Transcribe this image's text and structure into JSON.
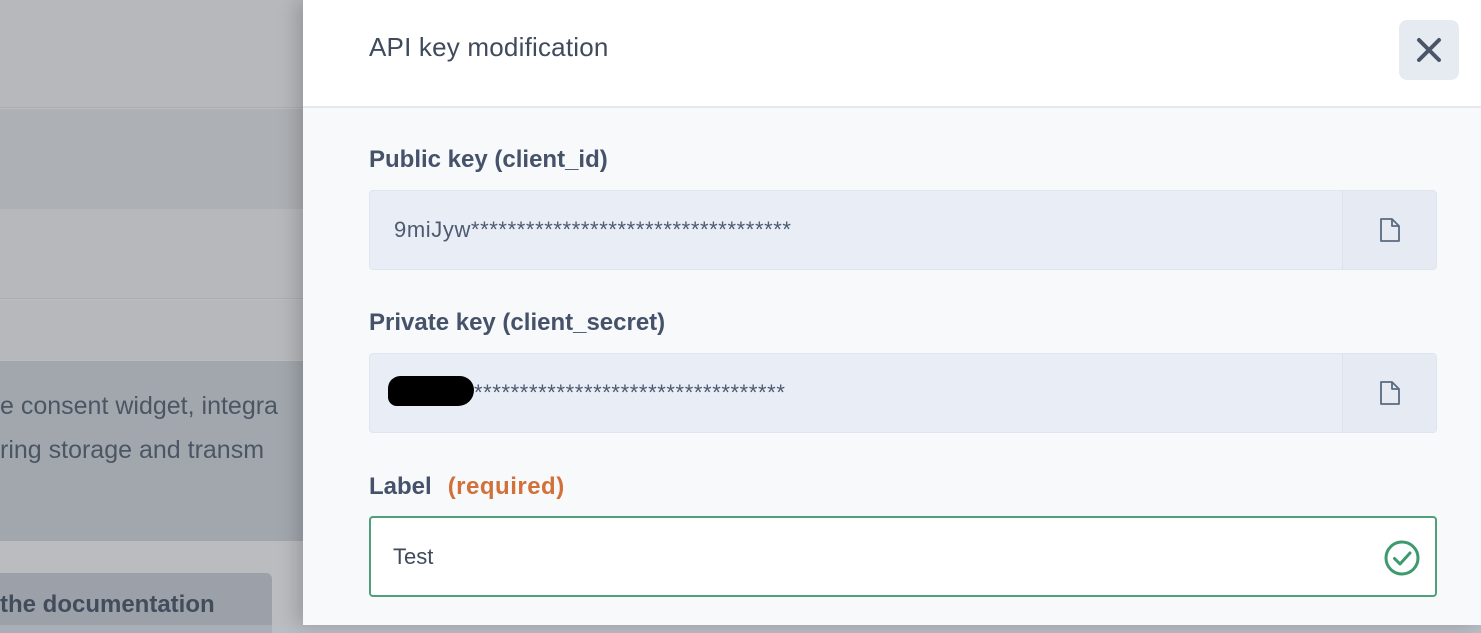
{
  "background": {
    "info_line_1": "e consent widget, integra",
    "info_line_2": "ring storage and transm",
    "doc_button_label": "the documentation"
  },
  "drawer": {
    "title": "API key modification",
    "close_icon": "close-icon",
    "public_key": {
      "label": "Public key (client_id)",
      "value": "9miJyw***********************************",
      "copy_icon": "file-copy-icon"
    },
    "private_key": {
      "label": "Private key (client_secret)",
      "value": "**********************************",
      "copy_icon": "file-copy-icon"
    },
    "label_field": {
      "label": "Label",
      "required_text": "(required)",
      "value": "Test",
      "status_icon": "check-circle-icon"
    }
  },
  "colors": {
    "accent_valid": "#4fa07a",
    "required": "#d2703a",
    "label_text": "#45526a"
  }
}
